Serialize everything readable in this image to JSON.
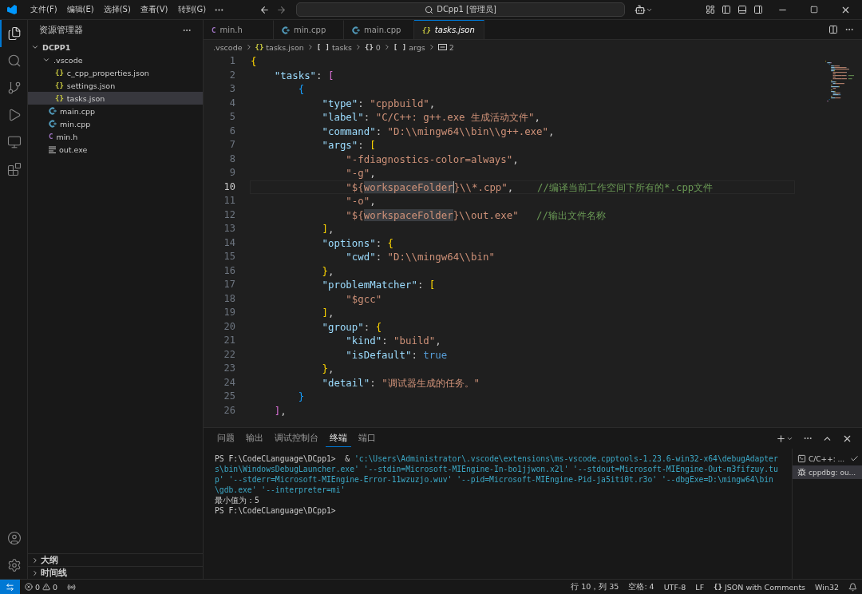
{
  "titlebar": {
    "menus": [
      "文件(F)",
      "编辑(E)",
      "选择(S)",
      "查看(V)",
      "转到(G)"
    ],
    "search": "DCpp1 [管理员]"
  },
  "activity": [
    {
      "kind": "explorer",
      "selected": true
    },
    {
      "kind": "search",
      "selected": false
    },
    {
      "kind": "git",
      "selected": false
    },
    {
      "kind": "debug",
      "selected": false
    },
    {
      "kind": "remote",
      "selected": false
    },
    {
      "kind": "extensions",
      "selected": false
    }
  ],
  "explorer": {
    "title": "资源管理器",
    "root": {
      "label": "DCPP1",
      "expanded": true,
      "children": [
        {
          "label": ".vscode",
          "kind": "folder",
          "expanded": true,
          "selected": false,
          "children": [
            {
              "label": "c_cpp_properties.json",
              "kind": "json",
              "glyph": "{}",
              "selected": false
            },
            {
              "label": "settings.json",
              "kind": "json",
              "glyph": "{}",
              "selected": false
            },
            {
              "label": "tasks.json",
              "kind": "json",
              "glyph": "{}",
              "selected": true
            }
          ]
        },
        {
          "label": "main.cpp",
          "kind": "cpp",
          "selected": false
        },
        {
          "label": "min.cpp",
          "kind": "cpp",
          "selected": false
        },
        {
          "label": "min.h",
          "kind": "c",
          "glyph": "C",
          "selected": false
        },
        {
          "label": "out.exe",
          "kind": "exe",
          "selected": false
        }
      ]
    },
    "sections": [
      {
        "label": "大纲",
        "expanded": false
      },
      {
        "label": "时间线",
        "expanded": false
      }
    ]
  },
  "tabs": [
    {
      "label": "min.h",
      "kind": "c",
      "glyph": "C",
      "selected": false
    },
    {
      "label": "min.cpp",
      "kind": "cpp",
      "selected": false
    },
    {
      "label": "main.cpp",
      "kind": "cpp",
      "selected": false
    },
    {
      "label": "tasks.json",
      "kind": "json",
      "glyph": "{}",
      "selected": true
    }
  ],
  "breadcrumbs": [
    {
      "label": ".vscode"
    },
    {
      "label": "tasks.json",
      "glyph": "{}",
      "kind": "json"
    },
    {
      "label": "tasks",
      "glyph": "[ ]"
    },
    {
      "label": "0",
      "glyph": "{}"
    },
    {
      "label": "args",
      "glyph": "[ ]"
    },
    {
      "label": "2",
      "kind": "value"
    }
  ],
  "code": [
    {
      "n": "1",
      "active": false,
      "tokens": [
        {
          "kind": "b1",
          "s": "{"
        }
      ]
    },
    {
      "n": "2",
      "active": false,
      "tokens": [
        {
          "kind": "key",
          "s": "    \"tasks\""
        },
        {
          "kind": "p",
          "s": ": "
        },
        {
          "kind": "b2",
          "s": "["
        }
      ]
    },
    {
      "n": "3",
      "active": false,
      "tokens": [
        {
          "kind": "b3",
          "s": "        {"
        }
      ]
    },
    {
      "n": "4",
      "active": false,
      "tokens": [
        {
          "kind": "key",
          "s": "            \"type\""
        },
        {
          "kind": "p",
          "s": ": "
        },
        {
          "kind": "str",
          "s": "\"cppbuild\""
        },
        {
          "kind": "p",
          "s": ","
        }
      ]
    },
    {
      "n": "5",
      "active": false,
      "tokens": [
        {
          "kind": "key",
          "s": "            \"label\""
        },
        {
          "kind": "p",
          "s": ": "
        },
        {
          "kind": "str",
          "s": "\"C/C++: g++.exe 生成活动文件\""
        },
        {
          "kind": "p",
          "s": ","
        }
      ]
    },
    {
      "n": "6",
      "active": false,
      "tokens": [
        {
          "kind": "key",
          "s": "            \"command\""
        },
        {
          "kind": "p",
          "s": ": "
        },
        {
          "kind": "str",
          "s": "\"D:\\\\mingw64\\\\bin\\\\g++.exe\""
        },
        {
          "kind": "p",
          "s": ","
        }
      ]
    },
    {
      "n": "7",
      "active": false,
      "tokens": [
        {
          "kind": "key",
          "s": "            \"args\""
        },
        {
          "kind": "p",
          "s": ": "
        },
        {
          "kind": "b1",
          "s": "["
        }
      ]
    },
    {
      "n": "8",
      "active": false,
      "tokens": [
        {
          "kind": "str",
          "s": "                \"-fdiagnostics-color=always\""
        },
        {
          "kind": "p",
          "s": ","
        }
      ]
    },
    {
      "n": "9",
      "active": false,
      "tokens": [
        {
          "kind": "str",
          "s": "                \"-g\""
        },
        {
          "kind": "p",
          "s": ","
        }
      ]
    },
    {
      "n": "10",
      "active": true,
      "tokens": [
        {
          "kind": "str",
          "s": "                \"${"
        },
        {
          "kind": "hl",
          "s": "workspaceFolder"
        },
        {
          "kind": "str",
          "s": "}\\\\*.cpp\""
        },
        {
          "kind": "p",
          "s": ","
        },
        {
          "kind": "cm",
          "s": "    //编译当前工作空间下所有的*.cpp文件"
        }
      ]
    },
    {
      "n": "11",
      "active": false,
      "tokens": [
        {
          "kind": "str",
          "s": "                \"-o\""
        },
        {
          "kind": "p",
          "s": ","
        }
      ]
    },
    {
      "n": "12",
      "active": false,
      "tokens": [
        {
          "kind": "str",
          "s": "                \"${"
        },
        {
          "kind": "hl",
          "s": "workspaceFolder"
        },
        {
          "kind": "str",
          "s": "}\\\\out.exe\""
        },
        {
          "kind": "cm",
          "s": "   //输出文件名称"
        }
      ]
    },
    {
      "n": "13",
      "active": false,
      "tokens": [
        {
          "kind": "b1",
          "s": "            ]"
        },
        {
          "kind": "p",
          "s": ","
        }
      ]
    },
    {
      "n": "14",
      "active": false,
      "tokens": [
        {
          "kind": "key",
          "s": "            \"options\""
        },
        {
          "kind": "p",
          "s": ": "
        },
        {
          "kind": "b1",
          "s": "{"
        }
      ]
    },
    {
      "n": "15",
      "active": false,
      "tokens": [
        {
          "kind": "key",
          "s": "                \"cwd\""
        },
        {
          "kind": "p",
          "s": ": "
        },
        {
          "kind": "str",
          "s": "\"D:\\\\mingw64\\\\bin\""
        }
      ]
    },
    {
      "n": "16",
      "active": false,
      "tokens": [
        {
          "kind": "b1",
          "s": "            }"
        },
        {
          "kind": "p",
          "s": ","
        }
      ]
    },
    {
      "n": "17",
      "active": false,
      "tokens": [
        {
          "kind": "key",
          "s": "            \"problemMatcher\""
        },
        {
          "kind": "p",
          "s": ": "
        },
        {
          "kind": "b1",
          "s": "["
        }
      ]
    },
    {
      "n": "18",
      "active": false,
      "tokens": [
        {
          "kind": "str",
          "s": "                \"$gcc\""
        }
      ]
    },
    {
      "n": "19",
      "active": false,
      "tokens": [
        {
          "kind": "b1",
          "s": "            ]"
        },
        {
          "kind": "p",
          "s": ","
        }
      ]
    },
    {
      "n": "20",
      "active": false,
      "tokens": [
        {
          "kind": "key",
          "s": "            \"group\""
        },
        {
          "kind": "p",
          "s": ": "
        },
        {
          "kind": "b1",
          "s": "{"
        }
      ]
    },
    {
      "n": "21",
      "active": false,
      "tokens": [
        {
          "kind": "key",
          "s": "                \"kind\""
        },
        {
          "kind": "p",
          "s": ": "
        },
        {
          "kind": "str",
          "s": "\"build\""
        },
        {
          "kind": "p",
          "s": ","
        }
      ]
    },
    {
      "n": "22",
      "active": false,
      "tokens": [
        {
          "kind": "key",
          "s": "                \"isDefault\""
        },
        {
          "kind": "p",
          "s": ": "
        },
        {
          "kind": "bool",
          "s": "true"
        }
      ]
    },
    {
      "n": "23",
      "active": false,
      "tokens": [
        {
          "kind": "b1",
          "s": "            }"
        },
        {
          "kind": "p",
          "s": ","
        }
      ]
    },
    {
      "n": "24",
      "active": false,
      "tokens": [
        {
          "kind": "key",
          "s": "            \"detail\""
        },
        {
          "kind": "p",
          "s": ": "
        },
        {
          "kind": "str",
          "s": "\"调试器生成的任务。\""
        }
      ]
    },
    {
      "n": "25",
      "active": false,
      "tokens": [
        {
          "kind": "b3",
          "s": "        }"
        }
      ]
    },
    {
      "n": "26",
      "active": false,
      "tokens": [
        {
          "kind": "b2",
          "s": "    ]"
        },
        {
          "kind": "p",
          "s": ","
        }
      ]
    }
  ],
  "panel": {
    "tabs": [
      {
        "label": "问题",
        "selected": false
      },
      {
        "label": "输出",
        "selected": false
      },
      {
        "label": "调试控制台",
        "selected": false
      },
      {
        "label": "终端",
        "selected": true
      },
      {
        "label": "端口",
        "selected": false
      }
    ],
    "terminal": [
      [
        {
          "kind": "prompt",
          "s": "PS F:\\CodeCLanguage\\DCpp1>"
        },
        {
          "kind": "op",
          "s": "  & "
        },
        {
          "kind": "arg",
          "s": "'c:\\Users\\Administrator\\.vscode\\extensions\\ms-vscode.cpptools-1.23.6-win32-x64\\debugAdapters\\bin\\WindowsDebugLauncher.exe' '--stdin=Microsoft-MIEngine-In-bo1jjwon.x2l' '--stdout=Microsoft-MIEngine-Out-m3fifzuy.tup' '--stderr=Microsoft-MIEngine-Error-11wzuzjo.wuv' '--pid=Microsoft-MIEngine-Pid-ja5iti0t.r3o' '--dbgExe=D:\\mingw64\\bin\\gdb.exe' '--interpreter=mi'"
        }
      ],
      [
        {
          "kind": "out",
          "s": "最小值为：5"
        }
      ],
      [
        {
          "kind": "prompt",
          "s": "PS F:\\CodeCLanguage\\DCpp1>"
        }
      ]
    ],
    "sessions": [
      {
        "label": "C/C++: ...",
        "kind": "terminal",
        "done": true,
        "selected": false
      },
      {
        "label": "cppdbg: ou...",
        "kind": "debug",
        "done": false,
        "selected": true
      }
    ]
  },
  "status": {
    "errors": "0",
    "warnings": "0",
    "right": [
      "行 10，列 35",
      "空格: 4",
      "UTF-8",
      "LF"
    ],
    "language_glyph": "{}",
    "language": "JSON with Comments",
    "platform": "Win32"
  }
}
